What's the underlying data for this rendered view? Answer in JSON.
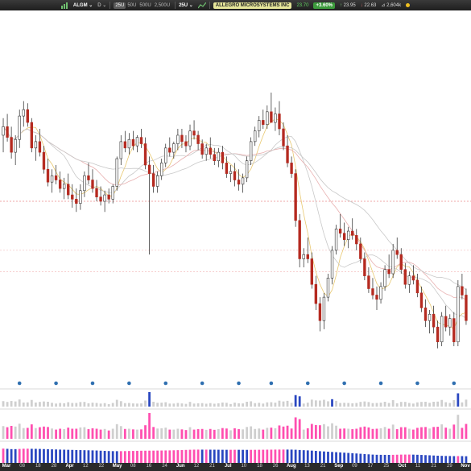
{
  "toolbar": {
    "symbol": "ALGM",
    "interval": "D",
    "zoom_options": [
      "25U",
      "50U",
      "500U",
      "2,500U"
    ],
    "zoom_active": "25U",
    "secondary_zoom": "25U",
    "company": "ALLEGRO MICROSYSTEMS INC",
    "last_price": "23.70",
    "change_pct": "+3.60%",
    "high": "23.95",
    "low": "22.63",
    "volume": "2,604k",
    "icons": [
      "chart-bars-icon",
      "chevron-down-icon",
      "line-chart-icon",
      "status-dot-icon"
    ]
  },
  "chart_data": {
    "type": "candlestick",
    "price_ylim": [
      19,
      36
    ],
    "reference_lines": [
      27.5,
      25.2,
      24.2
    ],
    "candles": [
      [
        30.6,
        31.4,
        29.8,
        31.0
      ],
      [
        31.0,
        31.6,
        30.3,
        30.5
      ],
      [
        30.5,
        31.0,
        29.5,
        29.8
      ],
      [
        29.8,
        30.6,
        29.2,
        30.4
      ],
      [
        30.4,
        31.8,
        30.0,
        31.5
      ],
      [
        31.5,
        32.2,
        31.0,
        31.8
      ],
      [
        31.8,
        32.1,
        31.0,
        31.2
      ],
      [
        31.2,
        31.4,
        29.8,
        30.0
      ],
      [
        30.0,
        30.6,
        29.4,
        30.3
      ],
      [
        30.3,
        30.9,
        29.6,
        29.8
      ],
      [
        29.8,
        30.1,
        28.8,
        29.0
      ],
      [
        29.0,
        29.5,
        28.2,
        28.4
      ],
      [
        28.4,
        29.0,
        27.9,
        28.7
      ],
      [
        28.7,
        29.2,
        28.3,
        28.5
      ],
      [
        28.5,
        28.9,
        27.9,
        28.1
      ],
      [
        28.1,
        28.6,
        27.6,
        28.3
      ],
      [
        28.3,
        28.8,
        27.6,
        27.8
      ],
      [
        27.8,
        28.3,
        27.2,
        27.6
      ],
      [
        27.6,
        28.1,
        27.0,
        27.4
      ],
      [
        27.4,
        28.3,
        27.1,
        28.0
      ],
      [
        28.0,
        28.9,
        27.7,
        28.7
      ],
      [
        28.7,
        29.3,
        28.3,
        28.5
      ],
      [
        28.5,
        29.0,
        27.9,
        28.1
      ],
      [
        28.1,
        28.5,
        27.5,
        27.7
      ],
      [
        27.7,
        28.2,
        27.3,
        27.5
      ],
      [
        27.5,
        28.0,
        27.0,
        27.8
      ],
      [
        27.8,
        28.1,
        27.4,
        27.6
      ],
      [
        27.6,
        28.3,
        27.4,
        28.2
      ],
      [
        28.2,
        29.6,
        28.0,
        29.5
      ],
      [
        29.5,
        30.6,
        29.2,
        30.3
      ],
      [
        30.3,
        30.8,
        29.8,
        30.0
      ],
      [
        30.0,
        30.7,
        29.7,
        30.4
      ],
      [
        30.4,
        30.8,
        29.9,
        30.1
      ],
      [
        30.1,
        30.6,
        29.8,
        30.5
      ],
      [
        30.5,
        30.9,
        30.0,
        30.2
      ],
      [
        30.2,
        30.5,
        29.0,
        29.2
      ],
      [
        29.2,
        29.6,
        25.0,
        28.8
      ],
      [
        28.8,
        29.2,
        27.9,
        28.2
      ],
      [
        28.2,
        28.9,
        27.9,
        28.7
      ],
      [
        28.7,
        29.5,
        28.5,
        29.3
      ],
      [
        29.3,
        30.2,
        29.1,
        30.0
      ],
      [
        30.0,
        30.5,
        29.6,
        29.8
      ],
      [
        29.8,
        30.3,
        29.5,
        30.2
      ],
      [
        30.2,
        30.9,
        29.9,
        30.6
      ],
      [
        30.6,
        30.9,
        30.0,
        30.3
      ],
      [
        30.3,
        30.6,
        29.8,
        30.1
      ],
      [
        30.1,
        31.1,
        29.9,
        30.8
      ],
      [
        30.8,
        31.3,
        30.4,
        30.6
      ],
      [
        30.6,
        30.8,
        29.9,
        30.2
      ],
      [
        30.2,
        30.4,
        29.5,
        29.7
      ],
      [
        29.7,
        30.2,
        29.4,
        30.0
      ],
      [
        30.0,
        30.5,
        29.5,
        29.7
      ],
      [
        29.7,
        30.0,
        29.2,
        29.4
      ],
      [
        29.4,
        30.0,
        29.1,
        29.8
      ],
      [
        29.8,
        30.1,
        29.0,
        29.3
      ],
      [
        29.3,
        29.6,
        28.6,
        28.8
      ],
      [
        28.8,
        29.2,
        28.4,
        28.9
      ],
      [
        28.9,
        29.3,
        28.2,
        28.5
      ],
      [
        28.5,
        29.0,
        28.0,
        28.3
      ],
      [
        28.3,
        28.8,
        27.9,
        28.6
      ],
      [
        28.6,
        29.6,
        28.4,
        29.4
      ],
      [
        29.4,
        30.5,
        29.2,
        30.3
      ],
      [
        30.3,
        31.0,
        30.1,
        30.8
      ],
      [
        30.8,
        31.5,
        30.5,
        31.3
      ],
      [
        31.3,
        31.8,
        30.9,
        31.1
      ],
      [
        31.1,
        32.0,
        30.9,
        31.7
      ],
      [
        31.7,
        32.6,
        31.4,
        31.2
      ],
      [
        31.2,
        31.9,
        30.8,
        31.6
      ],
      [
        31.6,
        32.2,
        30.6,
        30.9
      ],
      [
        30.9,
        31.2,
        29.9,
        30.1
      ],
      [
        30.1,
        30.6,
        29.1,
        29.3
      ],
      [
        29.3,
        29.6,
        28.6,
        28.8
      ],
      [
        28.8,
        29.0,
        26.3,
        26.6
      ],
      [
        26.6,
        26.9,
        24.4,
        24.8
      ],
      [
        24.8,
        25.3,
        24.4,
        25.0
      ],
      [
        25.0,
        25.8,
        24.6,
        24.8
      ],
      [
        24.8,
        25.1,
        23.4,
        23.6
      ],
      [
        23.6,
        24.0,
        22.4,
        22.7
      ],
      [
        22.7,
        23.0,
        21.4,
        21.9
      ],
      [
        21.9,
        23.2,
        21.5,
        23.0
      ],
      [
        23.0,
        24.1,
        22.8,
        23.9
      ],
      [
        23.9,
        25.4,
        23.6,
        25.2
      ],
      [
        25.2,
        26.4,
        25.0,
        26.2
      ],
      [
        26.2,
        26.9,
        25.8,
        26.0
      ],
      [
        26.0,
        26.5,
        25.4,
        25.7
      ],
      [
        25.7,
        26.3,
        25.3,
        26.1
      ],
      [
        26.1,
        26.7,
        25.7,
        25.9
      ],
      [
        25.9,
        26.2,
        25.2,
        25.5
      ],
      [
        25.5,
        25.8,
        24.6,
        24.8
      ],
      [
        24.8,
        25.1,
        23.8,
        24.0
      ],
      [
        24.0,
        24.4,
        23.2,
        23.4
      ],
      [
        23.4,
        23.9,
        22.9,
        23.1
      ],
      [
        23.1,
        23.5,
        22.4,
        22.9
      ],
      [
        22.9,
        23.7,
        22.7,
        23.5
      ],
      [
        23.5,
        24.5,
        23.3,
        24.3
      ],
      [
        24.3,
        25.0,
        23.9,
        24.1
      ],
      [
        24.1,
        25.5,
        23.9,
        25.2
      ],
      [
        25.2,
        25.8,
        24.8,
        25.0
      ],
      [
        25.0,
        25.3,
        24.1,
        24.3
      ],
      [
        24.3,
        24.6,
        23.4,
        23.6
      ],
      [
        23.6,
        24.2,
        23.2,
        24.0
      ],
      [
        24.0,
        24.5,
        23.6,
        23.8
      ],
      [
        23.8,
        24.1,
        23.0,
        23.2
      ],
      [
        23.2,
        23.5,
        22.3,
        22.5
      ],
      [
        22.5,
        22.9,
        21.6,
        21.9
      ],
      [
        21.9,
        22.4,
        21.3,
        22.2
      ],
      [
        22.2,
        22.6,
        21.3,
        21.6
      ],
      [
        21.6,
        21.9,
        20.6,
        20.9
      ],
      [
        20.9,
        22.3,
        20.7,
        22.1
      ],
      [
        22.1,
        22.6,
        21.4,
        21.6
      ],
      [
        21.6,
        22.2,
        21.2,
        22.0
      ],
      [
        22.0,
        22.3,
        20.7,
        20.9
      ],
      [
        20.9,
        23.8,
        20.7,
        23.5
      ],
      [
        23.5,
        24.1,
        22.9,
        23.1
      ],
      [
        23.1,
        23.4,
        21.7,
        21.9
      ]
    ],
    "flags_count": 13,
    "x_ticks": [
      {
        "label": "Mar",
        "month": true
      },
      {
        "label": "08"
      },
      {
        "label": "18"
      },
      {
        "label": "28"
      },
      {
        "label": "Apr",
        "month": true
      },
      {
        "label": "12"
      },
      {
        "label": "22"
      },
      {
        "label": "May",
        "month": true
      },
      {
        "label": "08"
      },
      {
        "label": "16"
      },
      {
        "label": "24"
      },
      {
        "label": "Jun",
        "month": true
      },
      {
        "label": "12"
      },
      {
        "label": "21"
      },
      {
        "label": "Jul",
        "month": true
      },
      {
        "label": "10"
      },
      {
        "label": "18"
      },
      {
        "label": "26"
      },
      {
        "label": "Aug",
        "month": true
      },
      {
        "label": "13"
      },
      {
        "label": "21"
      },
      {
        "label": "Sep",
        "month": true
      },
      {
        "label": "09"
      },
      {
        "label": "17"
      },
      {
        "label": "25"
      },
      {
        "label": "Oct",
        "month": true
      },
      {
        "label": "11"
      },
      {
        "label": "21"
      },
      {
        "label": "29"
      },
      {
        "label": "Nov",
        "month": true
      }
    ],
    "colors": {
      "up_body": "#ffffff",
      "down_body": "#b52a20",
      "wick": "#222222",
      "ma_yellow": "#e8c870",
      "ma_grey": "#c8c8c8",
      "ma_pink": "#e8b0b0",
      "ref_line": "#e05050",
      "flag": "#2f6fb0",
      "vol_pink": "#ff4fb0",
      "vol_blue": "#2a47c0",
      "vol_grey": "#cfcfcf"
    }
  }
}
